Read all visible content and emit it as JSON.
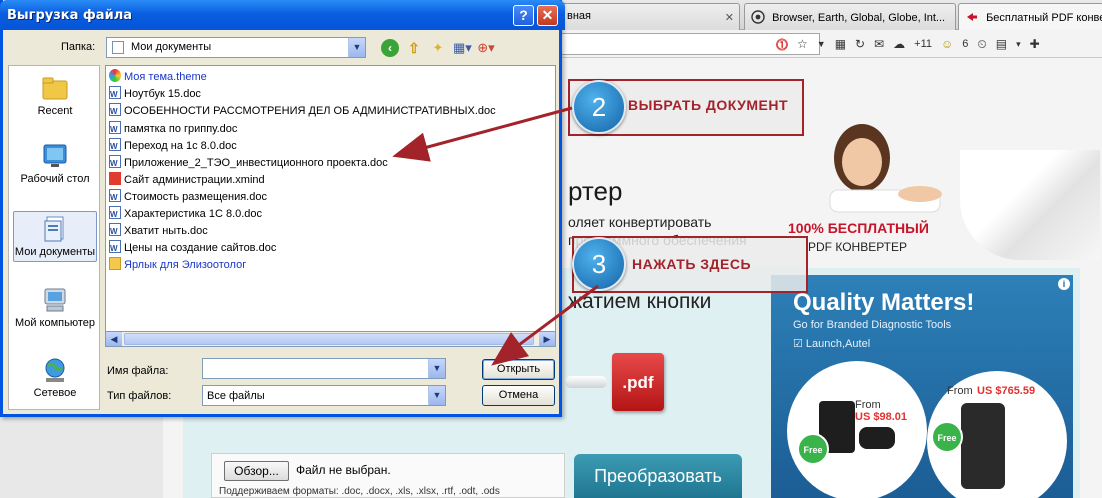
{
  "browser": {
    "tabs": [
      {
        "label": "вная",
        "active": false
      },
      {
        "label": "Browser, Earth, Global, Globe, Int...",
        "active": false
      },
      {
        "label": "Бесплатный PDF конвер",
        "active": true
      }
    ],
    "badge_count": "+11",
    "download_count": "6"
  },
  "page": {
    "hero_title": "ртер",
    "hero_line1": "оляет конвертировать",
    "hero_line2": "программного обеспечения",
    "press_text": "жатием кнопки",
    "free_label": "100% БЕСПЛАТНЫЙ",
    "free_sub": "PDF КОНВЕРТЕР",
    "pdf_icon_text": ".pdf",
    "browse_label": "Обзор...",
    "no_file_text": "Файл не выбран.",
    "formats_text": "Поддерживаем форматы: .doc, .docx, .xls, .xlsx, .rtf, .odt, .ods",
    "convert_label": "Преобразовать"
  },
  "ad": {
    "title": "Quality Matters!",
    "subtitle": "Go for Branded Diagnostic Tools",
    "brand": "☑ Launch,Autel",
    "left_from": "From",
    "left_price": "US $98.01",
    "right_from": "From",
    "right_price": "US $765.59",
    "free_badge": "Free",
    "info": "i"
  },
  "callouts": {
    "step2_number": "2",
    "step2_text": "ВЫБРАТЬ ДОКУМЕНТ",
    "step3_number": "3",
    "step3_text": "НАЖАТЬ ЗДЕСЬ",
    "accent_color": "#a3232b"
  },
  "dialog": {
    "title": "Выгрузка файла",
    "help_label": "?",
    "close_label": "✕",
    "folder_label": "Папка:",
    "folder_value": "Мои документы",
    "places": [
      {
        "label": "Recent"
      },
      {
        "label": "Рабочий стол"
      },
      {
        "label": "Мои документы"
      },
      {
        "label": "Мой компьютер"
      },
      {
        "label": "Сетевое"
      }
    ],
    "files": [
      {
        "name": "Моя тема.theme",
        "icon": "theme-icon"
      },
      {
        "name": "Ноутбук 15.doc",
        "icon": "word-doc-icon"
      },
      {
        "name": "ОСОБЕННОСТИ РАССМОТРЕНИЯ ДЕЛ ОБ АДМИНИСТРАТИВНЫХ.doc",
        "icon": "word-doc-icon"
      },
      {
        "name": "памятка по гриппу.doc",
        "icon": "word-doc-icon"
      },
      {
        "name": "Переход на 1с 8.0.doc",
        "icon": "word-doc-icon"
      },
      {
        "name": "Приложение_2_ТЭО_инвестиционного проекта.doc",
        "icon": "word-doc-icon"
      },
      {
        "name": "Сайт администрации.xmind",
        "icon": "xmind-icon"
      },
      {
        "name": "Стоимость размещения.doc",
        "icon": "word-doc-icon"
      },
      {
        "name": "Характеристика 1С 8.0.doc",
        "icon": "word-doc-icon"
      },
      {
        "name": "Хватит ныть.doc",
        "icon": "word-doc-icon"
      },
      {
        "name": "Цены на создание сайтов.doc",
        "icon": "word-doc-icon"
      },
      {
        "name": "Ярлык для Элизоотолог",
        "icon": "folder-shortcut-icon"
      }
    ],
    "filename_label": "Имя файла:",
    "filename_value": "",
    "filetype_label": "Тип файлов:",
    "filetype_value": "Все файлы",
    "open_label": "Открыть",
    "cancel_label": "Отмена"
  }
}
